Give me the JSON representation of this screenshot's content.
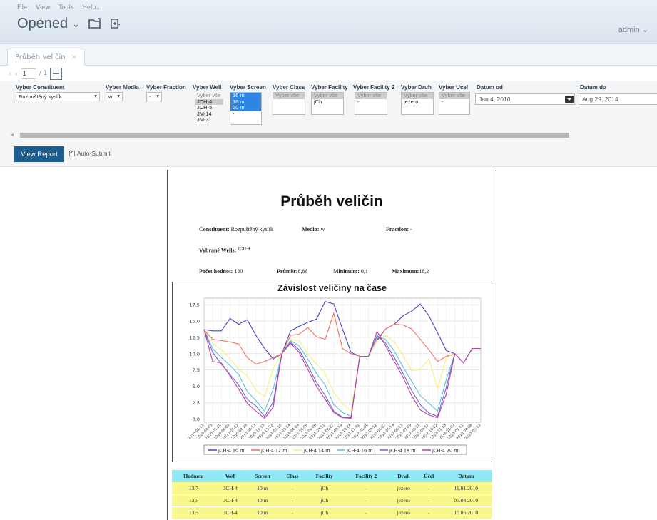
{
  "menu": [
    "File",
    "View",
    "Tools",
    "Help..."
  ],
  "header": {
    "title": "Opened",
    "user": "admin"
  },
  "tab": {
    "label": "Průběh veličin"
  },
  "pager": {
    "page": "1",
    "total": "/ 1"
  },
  "params": {
    "constituent": {
      "label": "Vyber Constituent",
      "value": "Rozpuštěný kyslík"
    },
    "media": {
      "label": "Vyber Media",
      "value": "w"
    },
    "fraction": {
      "label": "Vyber Fraction",
      "value": "-"
    },
    "well": {
      "label": "Vyber Well",
      "options": [
        "Vyber vše",
        "JCH-4",
        "JCH-5",
        "JM-14",
        "JM-3"
      ]
    },
    "screen": {
      "label": "Vyber Screen",
      "options": [
        "16 m",
        "18 m",
        "20 m",
        "-"
      ]
    },
    "class": {
      "label": "Vyber Class",
      "options": [
        "Vyber vše"
      ]
    },
    "facility": {
      "label": "Vyber Facility",
      "options": [
        "Vyber vše",
        "jCh"
      ]
    },
    "facility2": {
      "label": "Vyber Facility 2",
      "options": [
        "Vyber vše",
        "-"
      ]
    },
    "druh": {
      "label": "Vyber Druh",
      "options": [
        "Vyber vše",
        "jezero"
      ]
    },
    "ucel": {
      "label": "Vyber Ucel",
      "options": [
        "Vyber vše",
        "-"
      ]
    },
    "datum_od": {
      "label": "Datum od",
      "value": "Jan 4, 2010"
    },
    "datum_do": {
      "label": "Datum do",
      "value": "Aug 29, 2014"
    },
    "view_report": "View Report",
    "auto_submit": "Auto-Submit"
  },
  "report": {
    "title": "Průběh veličin",
    "constituent_label": "Constituent:",
    "constituent_value": "Rozpuštěný kyslík",
    "media_label": "Media:",
    "media_value": "w",
    "fraction_label": "Fraction:",
    "fraction_value": "-",
    "wells_label": "Vybrané Wells:",
    "wells_value": "JCH-4",
    "count_label": "Počet hodnot:",
    "count_value": "180",
    "avg_label": "Průměr:",
    "avg_value": "8,86",
    "min_label": "Minimum:",
    "min_value": "0,1",
    "max_label": "Maximum:",
    "max_value": "18,2",
    "table": {
      "headers": [
        "Hodnota",
        "Well",
        "Screen",
        "Class",
        "Facility",
        "Facility 2",
        "Druh",
        "Účel",
        "Datum"
      ],
      "rows": [
        [
          "13,7",
          "JCH-4",
          "10 m",
          "-",
          "jCh",
          "-",
          "jezero",
          "-",
          "11.01.2010"
        ],
        [
          "13,5",
          "JCH-4",
          "10 m",
          "-",
          "jCh",
          "-",
          "jezero",
          "-",
          "05.04.2010"
        ],
        [
          "13,5",
          "JCH-4",
          "10 m",
          "-",
          "jCh",
          "-",
          "jezero",
          "-",
          "10.05.2010"
        ]
      ]
    }
  },
  "chart_data": {
    "type": "line",
    "title": "Závislost veličiny na čase",
    "ylim": [
      -0.5,
      18.5
    ],
    "yticks": [
      0.0,
      2.5,
      5.0,
      7.5,
      10.0,
      12.5,
      15.0,
      17.5
    ],
    "x": [
      "2010-01-11",
      "2010-04-05",
      "2010-05-10",
      "2010-06-07",
      "2010-07-12",
      "2010-08-23",
      "2010-09-13",
      "2010-10-18",
      "2010-11-22",
      "2011-01-10",
      "2011-03-14",
      "2011-04-04",
      "2011-05-09",
      "2011-06-06",
      "2011-07-11",
      "2011-08-22",
      "2011-09-19",
      "2011-10-24",
      "2011-11-21",
      "2012-01-09",
      "2012-03-12",
      "2012-04-02",
      "2012-05-14",
      "2012-06-11",
      "2012-07-09",
      "2012-08-20",
      "2012-09-17",
      "2012-10-22",
      "2012-11-19",
      "2013-01-07",
      "2013-03-11",
      "2013-04-08",
      "2013-05-13"
    ],
    "x_tick_labels": [
      "2010-01-11",
      "2010-04-05",
      "2010-05-10",
      "2010-06-07",
      "2010-07-12",
      "2010-08-23",
      "2010-09-13",
      "2010-10-18",
      "2010-11-22",
      "2011-01-10",
      "2011-03-14",
      "2011-04-04",
      "2011-05-09",
      "2011-06-06",
      "2011-07-11",
      "2011-08-22",
      "2011-09-19",
      "2011-10-24",
      "2011-11-21",
      "2012-01-09",
      "2012-03-12",
      "2012-04-02",
      "2012-05-14",
      "2012-06-11",
      "2012-07-09",
      "2012-08-20",
      "2012-09-17",
      "2012-10-22",
      "2012-11-19",
      "2013-01-07",
      "2013-03-11",
      "2013-04-08",
      "2013-05-13"
    ],
    "legend_position": "bottom",
    "grid": true,
    "series": [
      {
        "name": "JCH-4 10 m",
        "color": "#4444c8",
        "values": [
          13.7,
          13.5,
          13.5,
          15.4,
          14.5,
          15.2,
          12.8,
          10.8,
          9.2,
          10.0,
          13.5,
          14.2,
          14.8,
          15.3,
          18.0,
          17.6,
          13.8,
          10.2,
          9.6,
          9.6,
          12.0,
          13.8,
          14.5,
          15.8,
          16.5,
          17.6,
          15.8,
          13.2,
          10.5,
          10.0,
          8.6,
          10.8,
          10.8
        ]
      },
      {
        "name": "JCH-4 12 m",
        "color": "#f07060",
        "values": [
          13.7,
          12.2,
          12.0,
          11.8,
          11.5,
          9.4,
          8.4,
          8.8,
          9.4,
          10.0,
          12.8,
          13.0,
          14.0,
          12.6,
          12.2,
          16.2,
          10.8,
          10.0,
          9.6,
          9.6,
          12.2,
          13.8,
          14.5,
          14.4,
          13.8,
          12.2,
          10.6,
          8.8,
          9.6,
          10.0,
          8.6,
          10.8,
          10.8
        ]
      },
      {
        "name": "JCH-4 14 m",
        "color": "#f5f07a",
        "values": [
          13.7,
          11.6,
          10.6,
          9.2,
          7.6,
          6.6,
          4.4,
          3.4,
          7.8,
          10.0,
          12.2,
          12.0,
          10.0,
          8.4,
          7.0,
          4.0,
          2.4,
          1.2,
          9.6,
          9.6,
          12.0,
          12.8,
          11.8,
          9.8,
          7.4,
          7.6,
          9.2,
          4.6,
          9.4,
          10.0,
          8.6,
          10.8,
          10.8
        ]
      },
      {
        "name": "JCH-4 16 m",
        "color": "#60c0e0",
        "values": [
          13.7,
          10.8,
          9.4,
          8.2,
          6.8,
          4.2,
          2.8,
          1.2,
          4.6,
          10.0,
          12.0,
          11.2,
          9.2,
          7.0,
          5.2,
          2.2,
          1.0,
          0.4,
          9.6,
          9.6,
          12.6,
          12.2,
          10.4,
          8.0,
          5.8,
          3.6,
          2.4,
          1.2,
          6.0,
          10.0,
          8.6,
          10.8,
          10.8
        ]
      },
      {
        "name": "JCH-4 18 m",
        "color": "#6666d8",
        "values": [
          13.7,
          10.2,
          8.4,
          6.8,
          5.2,
          3.0,
          2.0,
          0.4,
          2.6,
          10.0,
          11.8,
          10.6,
          8.2,
          5.6,
          3.6,
          1.2,
          0.3,
          0.2,
          9.6,
          9.6,
          12.8,
          11.6,
          9.4,
          7.0,
          4.4,
          2.2,
          0.9,
          0.4,
          4.8,
          10.0,
          8.6,
          10.8,
          10.8
        ]
      },
      {
        "name": "JCH-4 20 m",
        "color": "#c040a0",
        "values": [
          13.7,
          8.8,
          8.6,
          6.6,
          4.6,
          2.4,
          1.2,
          0.1,
          1.8,
          10.0,
          11.6,
          10.2,
          7.6,
          5.0,
          3.0,
          1.0,
          0.2,
          0.1,
          9.6,
          9.6,
          13.4,
          11.2,
          8.8,
          6.4,
          3.6,
          1.4,
          0.6,
          0.2,
          3.8,
          10.0,
          8.6,
          10.8,
          10.8
        ]
      }
    ]
  }
}
